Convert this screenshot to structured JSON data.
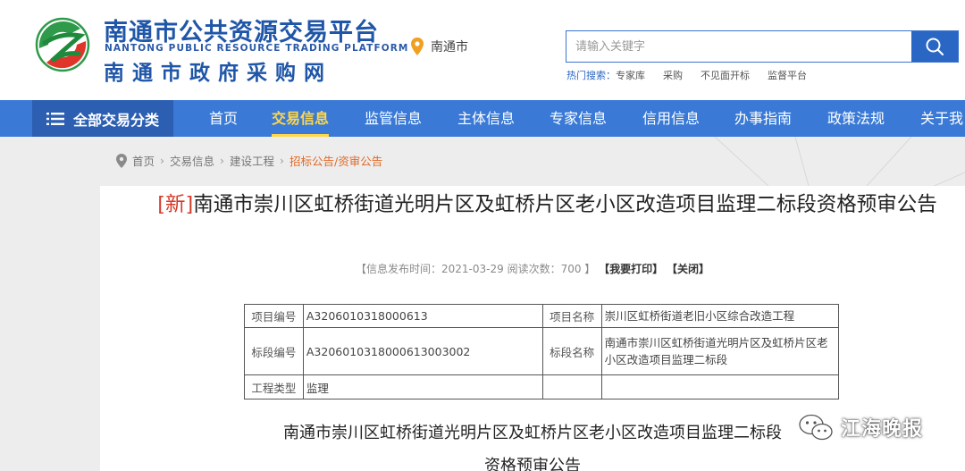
{
  "header": {
    "title": "南通市公共资源交易平台",
    "title_en": "NANTONG PUBLIC RESOURCE TRADING PLATFORM",
    "subtitle": "南通市政府采购网",
    "location": "南通市",
    "search_placeholder": "请输入关键字",
    "hot_label": "热门搜索：",
    "hot_items": [
      "专家库",
      "采购",
      "不见面开标",
      "监督平台"
    ]
  },
  "nav": {
    "all_label": "全部交易分类",
    "items": [
      "首页",
      "交易信息",
      "监管信息",
      "主体信息",
      "专家信息",
      "信用信息",
      "办事指南",
      "政策法规",
      "关于我"
    ]
  },
  "breadcrumb": [
    "首页",
    "交易信息",
    "建设工程",
    "招标公告/资审公告"
  ],
  "article": {
    "tag": "[新]",
    "title": "南通市崇川区虹桥街道光明片区及虹桥片区老小区改造项目监理二标段资格预审公告",
    "meta_prefix": "【信息发布时间：2021-03-29 阅读次数：700 】",
    "print_label": "【我要打印】",
    "close_label": "【关闭】"
  },
  "table": {
    "rows": [
      {
        "l1": "项目编号",
        "v1": "A3206010318000613",
        "l2": "项目名称",
        "v2": "崇川区虹桥街道老旧小区综合改造工程"
      },
      {
        "l1": "标段编号",
        "v1": "A3206010318000613003002",
        "l2": "标段名称",
        "v2": "南通市崇川区虹桥街道光明片区及虹桥片区老小区改造项目监理二标段"
      },
      {
        "l1": "工程类型",
        "v1": "监理",
        "l2": "",
        "v2": ""
      }
    ]
  },
  "doc": {
    "title_line1": "南通市崇川区虹桥街道光明片区及虹桥片区老小区改造项目监理二标段",
    "title_line2": "资格预审公告"
  },
  "watermark": "江海晚报",
  "colors": {
    "brand_blue": "#1f56a8",
    "nav_blue": "#3a7ad6",
    "active_yellow": "#ffd74a",
    "new_red": "#d43a2a",
    "breadcrumb_orange": "#e06a28"
  }
}
